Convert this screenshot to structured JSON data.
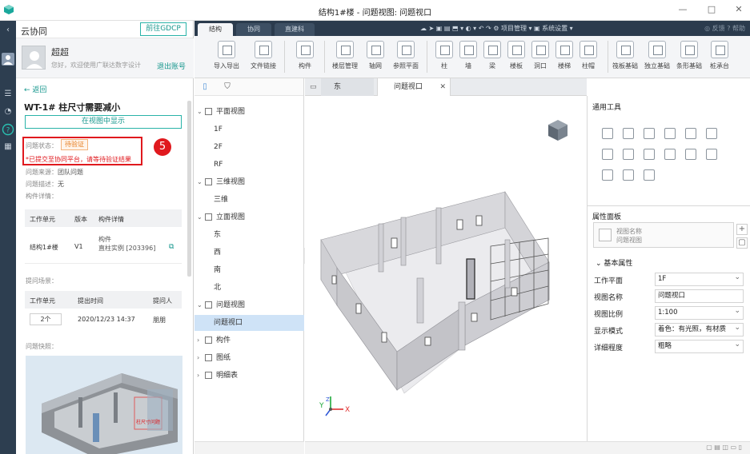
{
  "window": {
    "title": "结构1#楼 - 问题视图: 问题视口",
    "controls": [
      "—",
      "□",
      "✕"
    ]
  },
  "leftbar": {
    "items": [
      "collapse-arrow",
      "user-icon",
      "list-icon",
      "compass-icon",
      "question-icon",
      "grid-icon"
    ]
  },
  "collab": {
    "title": "云协同",
    "goto_button": "前往GDCP",
    "user_name": "超超",
    "greeting": "您好，欢迎使用广联达数字设计",
    "logout": "退出账号",
    "back": "← 返回",
    "issue_title": "WT-1# 柱尺寸需要减小",
    "show_in_view": "在视图中显示",
    "status_label": "问题状态：",
    "status_value": "待验证",
    "status_note": "*已提交至协同平台，请等待验证结果",
    "callout_number": "5",
    "source_label": "问题来源：",
    "source_value": "团队问题",
    "desc_label": "问题描述：",
    "desc_value": "无",
    "component_detail_label": "构件详情：",
    "comp_table": {
      "headers": [
        "工作单元",
        "版本",
        "构件详情"
      ],
      "row": {
        "unit": "结构1#楼",
        "version": "V1",
        "detail_line1": "构件",
        "detail_line2": "直柱实例 [203396]"
      }
    },
    "scene_label": "提问场景：",
    "scene_table": {
      "headers": [
        "工作单元",
        "提出时间",
        "提问人"
      ],
      "row": {
        "unit": "2个",
        "time": "2020/12/23 14:37",
        "person": "朋朋"
      }
    },
    "snapshot_label": "问题快照：",
    "snapshot_tag": "柱尺寸问题"
  },
  "ribbon": {
    "tabs": [
      "结构",
      "协同",
      "直建科"
    ],
    "quick_tools": "☁ ➤ ▣ ▤ ⬒ ▾ ◐ ▾ ↶ ↷ ⚙ 项目管理 ▾ ▣ 系统设置 ▾",
    "right_tools": "◎ 反馈  ? 帮助",
    "buttons": [
      {
        "label": "导入导出"
      },
      {
        "label": "文件链接"
      },
      {
        "label": "构件"
      },
      {
        "label": "楼层管理"
      },
      {
        "label": "轴网"
      },
      {
        "label": "参照平面"
      },
      {
        "label": "柱"
      },
      {
        "label": "墙"
      },
      {
        "label": "梁"
      },
      {
        "label": "楼板"
      },
      {
        "label": "洞口"
      },
      {
        "label": "楼梯"
      },
      {
        "label": "柱帽"
      },
      {
        "label": "筏板基础"
      },
      {
        "label": "独立基础"
      },
      {
        "label": "条形基础"
      },
      {
        "label": "桩承台"
      }
    ]
  },
  "tree": {
    "nodes": [
      {
        "label": "平面视图",
        "level": 0,
        "expanded": true
      },
      {
        "label": "1F",
        "level": 1
      },
      {
        "label": "2F",
        "level": 1
      },
      {
        "label": "RF",
        "level": 1
      },
      {
        "label": "三维视图",
        "level": 0,
        "expanded": true
      },
      {
        "label": "三维",
        "level": 1
      },
      {
        "label": "立面视图",
        "level": 0,
        "expanded": true
      },
      {
        "label": "东",
        "level": 1
      },
      {
        "label": "西",
        "level": 1
      },
      {
        "label": "南",
        "level": 1
      },
      {
        "label": "北",
        "level": 1
      },
      {
        "label": "问题视图",
        "level": 0,
        "expanded": true
      },
      {
        "label": "问题视口",
        "level": 1,
        "selected": true
      },
      {
        "label": "构件",
        "level": 0,
        "expanded": false
      },
      {
        "label": "图纸",
        "level": 0,
        "expanded": false
      },
      {
        "label": "明细表",
        "level": 0,
        "expanded": false
      }
    ]
  },
  "viewport": {
    "tabs": [
      {
        "label": "东"
      },
      {
        "label": "问题视口",
        "active": true
      }
    ],
    "axes": {
      "x": "X",
      "y": "Y",
      "z": "Z"
    }
  },
  "tools": {
    "title": "通用工具"
  },
  "props": {
    "title": "属性面板",
    "selector_line1": "视图名称",
    "selector_line2": "问题视图",
    "section": "⌄ 基本属性",
    "rows": [
      {
        "key": "工作平面",
        "value": "1F",
        "dropdown": true
      },
      {
        "key": "视图名称",
        "value": "问题视口",
        "dropdown": false
      },
      {
        "key": "视图比例",
        "value": "1:100",
        "dropdown": true
      },
      {
        "key": "显示模式",
        "value": "着色：有光照，有材质",
        "dropdown": true
      },
      {
        "key": "详细程度",
        "value": "粗略",
        "dropdown": true
      }
    ]
  },
  "colors": {
    "accent": "#16978d",
    "alert": "#e0191e",
    "ribbon_dark": "#2b3b4d",
    "selected": "#cfe3f7"
  }
}
